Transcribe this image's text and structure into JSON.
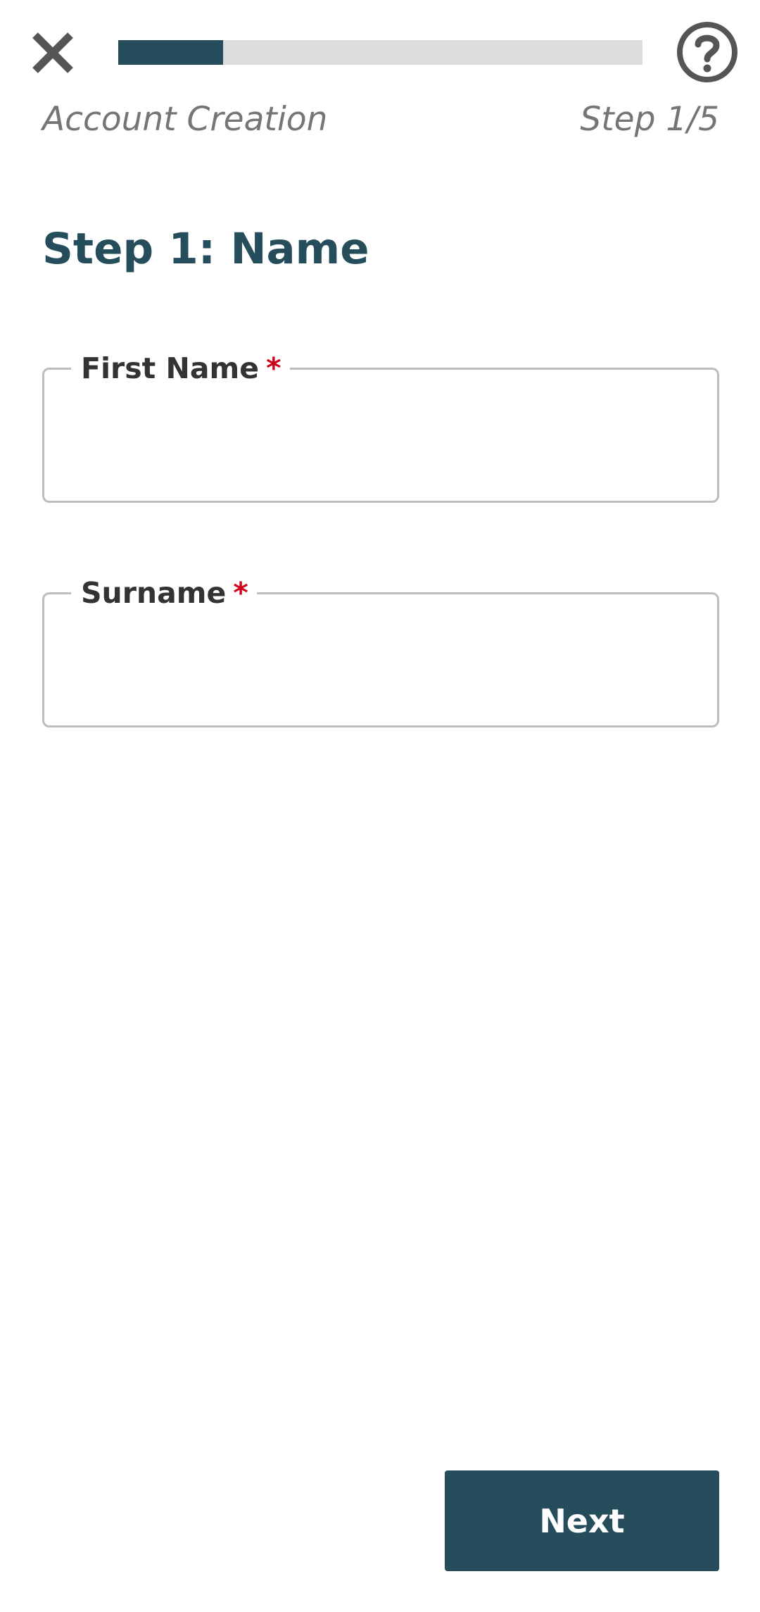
{
  "header": {
    "close_icon": "close-icon",
    "help_icon": "help-circle-icon",
    "progress": {
      "fraction": 0.2
    },
    "flow_title": "Account Creation",
    "step_indicator": "Step 1/5"
  },
  "main": {
    "step_title": "Step 1: Name",
    "fields": [
      {
        "label": "First Name",
        "required_mark": "*",
        "value": ""
      },
      {
        "label": "Surname",
        "required_mark": "*",
        "value": ""
      }
    ]
  },
  "footer": {
    "next_label": "Next"
  },
  "colors": {
    "accent": "#264d5c",
    "progress_track": "#dcdcdc",
    "required": "#d0021b",
    "icon": "#555555",
    "muted_text": "#757575"
  }
}
